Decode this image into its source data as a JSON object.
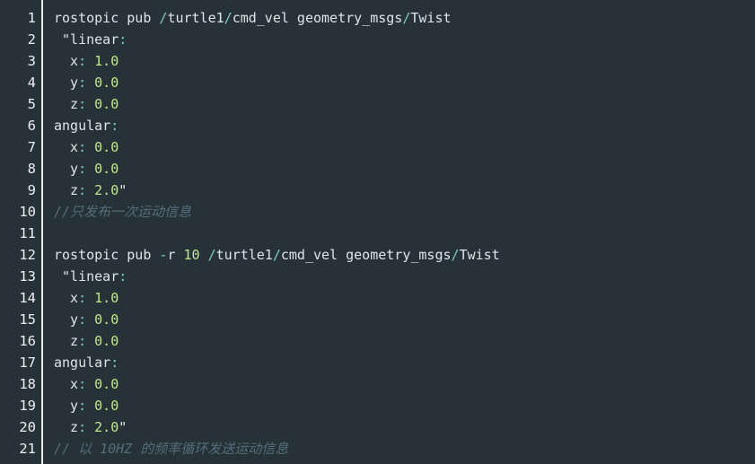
{
  "editor": {
    "line_numbers": [
      "1",
      "2",
      "3",
      "4",
      "5",
      "6",
      "7",
      "8",
      "9",
      "10",
      "11",
      "12",
      "13",
      "14",
      "15",
      "16",
      "17",
      "18",
      "19",
      "20",
      "21"
    ],
    "lines": [
      [
        {
          "t": "rostopic pub ",
          "k": "t"
        },
        {
          "t": "/",
          "k": "p"
        },
        {
          "t": "turtle1",
          "k": "t"
        },
        {
          "t": "/",
          "k": "p"
        },
        {
          "t": "cmd_vel geometry_msgs",
          "k": "t"
        },
        {
          "t": "/",
          "k": "p"
        },
        {
          "t": "Twist",
          "k": "t"
        }
      ],
      [
        {
          "t": " \"linear",
          "k": "t"
        },
        {
          "t": ":",
          "k": "p"
        }
      ],
      [
        {
          "t": "  x",
          "k": "t"
        },
        {
          "t": ": ",
          "k": "p"
        },
        {
          "t": "1.0",
          "k": "n"
        }
      ],
      [
        {
          "t": "  y",
          "k": "t"
        },
        {
          "t": ": ",
          "k": "p"
        },
        {
          "t": "0.0",
          "k": "n"
        }
      ],
      [
        {
          "t": "  z",
          "k": "t"
        },
        {
          "t": ": ",
          "k": "p"
        },
        {
          "t": "0.0",
          "k": "n"
        }
      ],
      [
        {
          "t": "angular",
          "k": "t"
        },
        {
          "t": ":",
          "k": "p"
        }
      ],
      [
        {
          "t": "  x",
          "k": "t"
        },
        {
          "t": ": ",
          "k": "p"
        },
        {
          "t": "0.0",
          "k": "n"
        }
      ],
      [
        {
          "t": "  y",
          "k": "t"
        },
        {
          "t": ": ",
          "k": "p"
        },
        {
          "t": "0.0",
          "k": "n"
        }
      ],
      [
        {
          "t": "  z",
          "k": "t"
        },
        {
          "t": ": ",
          "k": "p"
        },
        {
          "t": "2.0",
          "k": "n"
        },
        {
          "t": "\"",
          "k": "t"
        }
      ],
      [
        {
          "t": "//只发布一次运动信息",
          "k": "c"
        }
      ],
      [],
      [
        {
          "t": "rostopic pub ",
          "k": "t"
        },
        {
          "t": "-",
          "k": "p"
        },
        {
          "t": "r ",
          "k": "t"
        },
        {
          "t": "10",
          "k": "n"
        },
        {
          "t": " ",
          "k": "t"
        },
        {
          "t": "/",
          "k": "p"
        },
        {
          "t": "turtle1",
          "k": "t"
        },
        {
          "t": "/",
          "k": "p"
        },
        {
          "t": "cmd_vel geometry_msgs",
          "k": "t"
        },
        {
          "t": "/",
          "k": "p"
        },
        {
          "t": "Twist",
          "k": "t"
        }
      ],
      [
        {
          "t": " \"linear",
          "k": "t"
        },
        {
          "t": ":",
          "k": "p"
        }
      ],
      [
        {
          "t": "  x",
          "k": "t"
        },
        {
          "t": ": ",
          "k": "p"
        },
        {
          "t": "1.0",
          "k": "n"
        }
      ],
      [
        {
          "t": "  y",
          "k": "t"
        },
        {
          "t": ": ",
          "k": "p"
        },
        {
          "t": "0.0",
          "k": "n"
        }
      ],
      [
        {
          "t": "  z",
          "k": "t"
        },
        {
          "t": ": ",
          "k": "p"
        },
        {
          "t": "0.0",
          "k": "n"
        }
      ],
      [
        {
          "t": "angular",
          "k": "t"
        },
        {
          "t": ":",
          "k": "p"
        }
      ],
      [
        {
          "t": "  x",
          "k": "t"
        },
        {
          "t": ": ",
          "k": "p"
        },
        {
          "t": "0.0",
          "k": "n"
        }
      ],
      [
        {
          "t": "  y",
          "k": "t"
        },
        {
          "t": ": ",
          "k": "p"
        },
        {
          "t": "0.0",
          "k": "n"
        }
      ],
      [
        {
          "t": "  z",
          "k": "t"
        },
        {
          "t": ": ",
          "k": "p"
        },
        {
          "t": "2.0",
          "k": "n"
        },
        {
          "t": "\"",
          "k": "t"
        }
      ],
      [
        {
          "t": "// 以 10HZ 的频率循环发送运动信息",
          "k": "c"
        }
      ]
    ]
  },
  "colors": {
    "background": "#263238",
    "text": "#dfe5e8",
    "punctuation": "#80cbc4",
    "number": "#c3e88d",
    "comment": "#546e7a",
    "gutter_border": "#e8ecef"
  }
}
